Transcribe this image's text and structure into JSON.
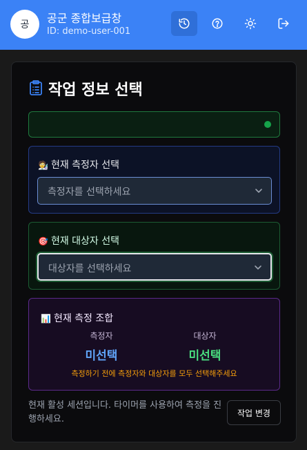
{
  "header": {
    "avatar_text": "공",
    "user_name": "공군 종합보급창",
    "user_id": "ID: demo-user-001",
    "buttons": [
      {
        "icon": "history-icon"
      },
      {
        "icon": "help-icon"
      },
      {
        "icon": "sun-icon"
      },
      {
        "icon": "logout-icon"
      }
    ],
    "colors": {
      "bar": "#3b82f6",
      "active_button": "#2f6fd8"
    }
  },
  "card": {
    "title": "작업 정보 선택",
    "title_icon": "clipboard-icon",
    "status": {
      "dot_color": "#16a34a"
    },
    "measurer": {
      "label_icons": "🧑‍🔬",
      "label": "현재 측정자 선택",
      "placeholder": "측정자를 선택하세요"
    },
    "target": {
      "label_icon": "🎯",
      "label": "현재 대상자 선택",
      "placeholder": "대상자를 선택하세요"
    },
    "combo": {
      "label_icon": "📊",
      "label": "현재 측정 조합",
      "measurer_label": "측정자",
      "measurer_value": "미선택",
      "target_label": "대상자",
      "target_value": "미선택",
      "warning": "측정하기 전에 측정자와 대상자를 모두 선택해주세요"
    },
    "footer_text": "현재 활성 세션입니다. 타이머를 사용하여 측정을 진행하세요.",
    "change_button": "작업 변경"
  }
}
